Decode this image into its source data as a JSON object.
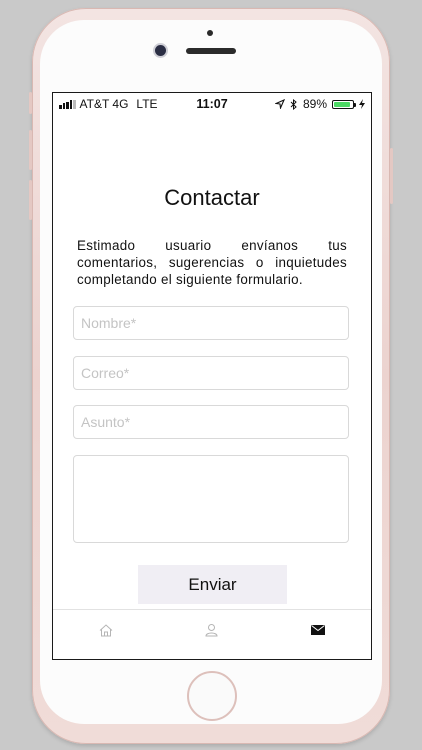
{
  "status_bar": {
    "carrier": "AT&T 4G",
    "network": "LTE",
    "time": "11:07",
    "battery_percent": "89%",
    "battery_level": 0.89,
    "battery_color": "#4cd964"
  },
  "page": {
    "title": "Contactar",
    "description": "Estimado usuario envíanos tus comentarios, sugerencias o inquietudes completando el siguiente formulario."
  },
  "form": {
    "name_placeholder": "Nombre*",
    "email_placeholder": "Correo*",
    "subject_placeholder": "Asunto*",
    "message_placeholder": "",
    "submit_label": "Enviar"
  },
  "tab_bar": {
    "items": [
      {
        "icon": "home-icon",
        "active": false
      },
      {
        "icon": "user-icon",
        "active": false
      },
      {
        "icon": "mail-icon",
        "active": true
      }
    ]
  }
}
